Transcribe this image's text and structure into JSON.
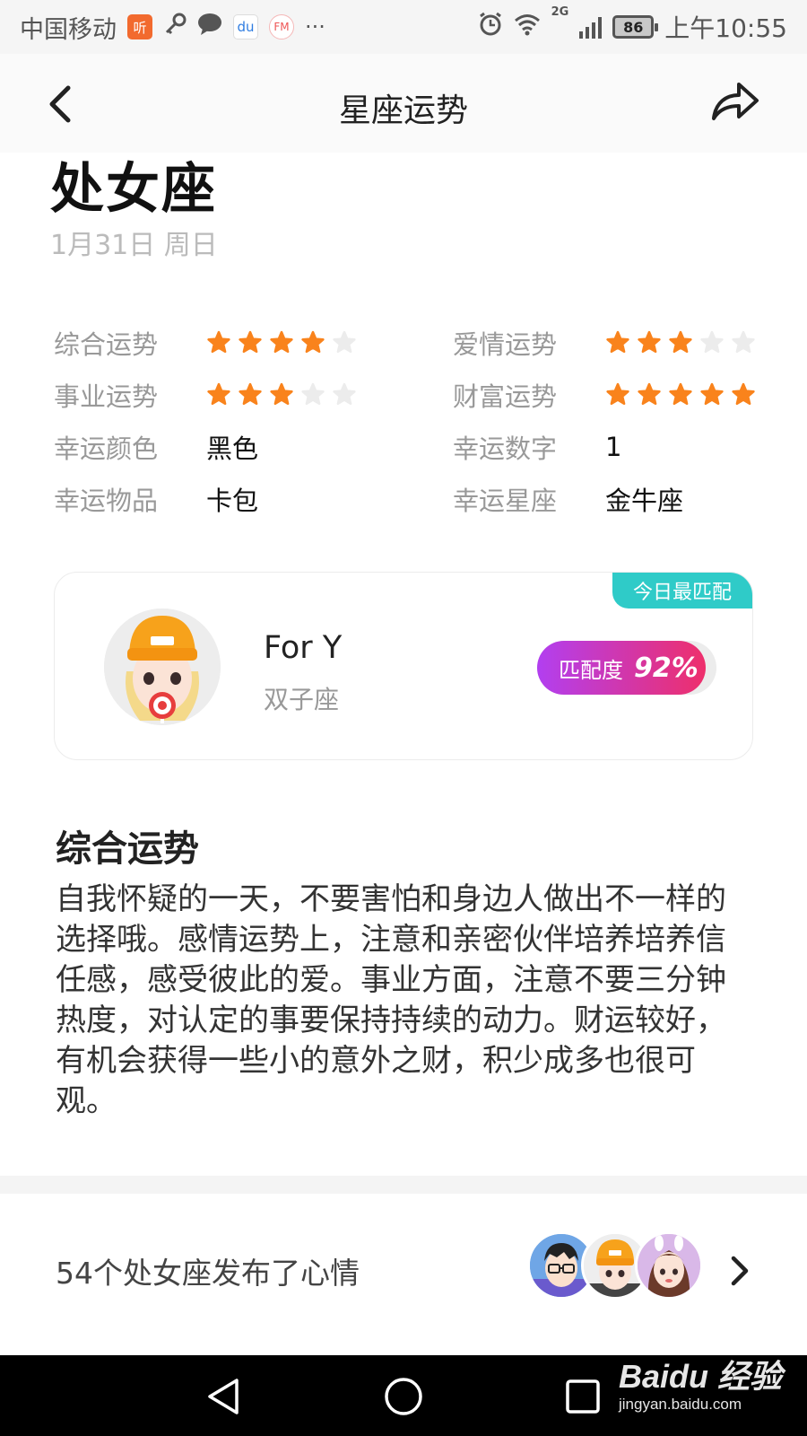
{
  "status_bar": {
    "carrier": "中国移动",
    "app_icon_1": "听",
    "app_icon_2": "du",
    "app_icon_3": "FM",
    "more": "···",
    "network": "2G",
    "battery": "86",
    "time": "上午10:55"
  },
  "nav": {
    "title": "星座运势",
    "back_icon": "chevron-left-icon",
    "share_icon": "share-icon"
  },
  "header": {
    "sign": "处女座",
    "date": "1月31日 周日"
  },
  "fortune": {
    "overall": {
      "label": "综合运势",
      "stars": 4,
      "max": 5
    },
    "love": {
      "label": "爱情运势",
      "stars": 3,
      "max": 5
    },
    "career": {
      "label": "事业运势",
      "stars": 3,
      "max": 5
    },
    "wealth": {
      "label": "财富运势",
      "stars": 5,
      "max": 5
    },
    "lucky_color": {
      "label": "幸运颜色",
      "value": "黑色"
    },
    "lucky_number": {
      "label": "幸运数字",
      "value": "1"
    },
    "lucky_item": {
      "label": "幸运物品",
      "value": "卡包"
    },
    "lucky_sign": {
      "label": "幸运星座",
      "value": "金牛座"
    }
  },
  "match": {
    "badge": "今日最匹配",
    "name": "For Y",
    "sign": "双子座",
    "score_label": "匹配度",
    "score_value": "92%",
    "score": 0.92
  },
  "overview": {
    "title": "综合运势",
    "body": "自我怀疑的一天，不要害怕和身边人做出不一样的选择哦。感情运势上，注意和亲密伙伴培养培养信任感，感受彼此的爱。事业方面，注意不要三分钟热度，对认定的事要保持持续的动力。财运较好，有机会获得一些小的意外之财，积少成多也很可观。"
  },
  "mood": {
    "text": "54个处女座发布了心情"
  },
  "watermark": {
    "main": "Baidu 经验",
    "sub": "jingyan.baidu.com"
  },
  "colors": {
    "star_on": "#f9831c",
    "star_off": "#ececec",
    "badge": "#2fcbc8",
    "pill_start": "#b23ff0",
    "pill_end": "#ee2f6b"
  }
}
